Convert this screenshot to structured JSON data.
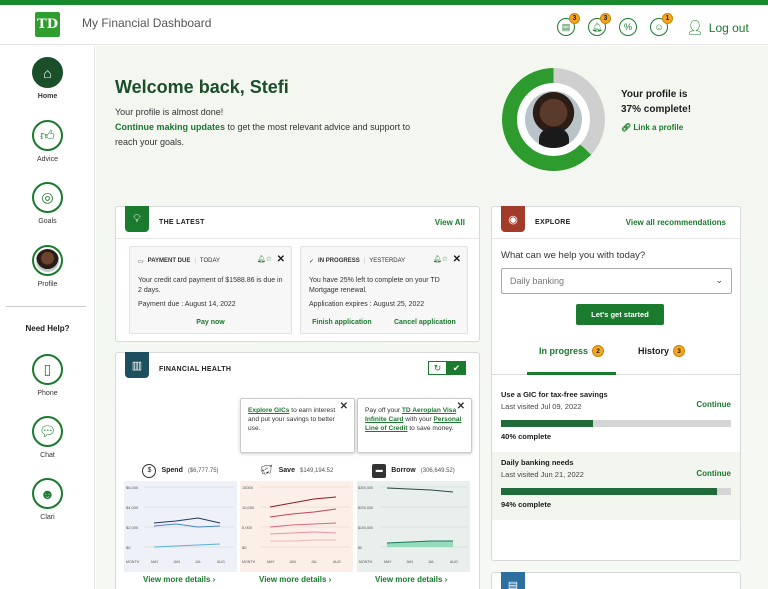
{
  "header": {
    "logo": "TD",
    "app_title": "My Financial Dashboard",
    "icons": [
      {
        "name": "statement-icon",
        "badge": "3"
      },
      {
        "name": "bell-icon",
        "badge": "3"
      },
      {
        "name": "offers-icon",
        "badge": ""
      },
      {
        "name": "goals-icon",
        "badge": "1"
      }
    ],
    "logout": "Log out"
  },
  "sidebar": {
    "items": [
      {
        "label": "Home",
        "icon": "home-icon"
      },
      {
        "label": "Advice",
        "icon": "thumbs-up-icon"
      },
      {
        "label": "Goals",
        "icon": "target-icon"
      },
      {
        "label": "Profile",
        "icon": "profile-avatar"
      }
    ],
    "need_help": "Need Help?",
    "help_items": [
      {
        "label": "Phone",
        "icon": "phone-icon"
      },
      {
        "label": "Chat",
        "icon": "chat-icon"
      },
      {
        "label": "Clari",
        "icon": "bot-icon"
      }
    ]
  },
  "welcome": {
    "title": "Welcome back, Stefi",
    "line1": "Your profile is almost done!",
    "link": "Continue making updates",
    "line2": " to get the most relevant advice and support to reach your goals."
  },
  "profile": {
    "complete_line1": "Your profile is",
    "complete_line2": "37% complete!",
    "percent": 37,
    "link": "Link a profile"
  },
  "latest": {
    "title": "THE LATEST",
    "view_all": "View All",
    "items": [
      {
        "status": "PAYMENT DUE",
        "when": "TODAY",
        "text": "Your credit card payment of $1588.86 is due in 2 days.",
        "detail": "Payment due : August 14, 2022",
        "actions": [
          "Pay now"
        ]
      },
      {
        "status": "IN PROGRESS",
        "when": "YESTERDAY",
        "text": "You have 25% left to complete on your TD Mortgage renewal.",
        "detail": "Application expires : August 25, 2022",
        "actions": [
          "Finish application",
          "Cancel application"
        ]
      }
    ]
  },
  "health": {
    "title": "FINANCIAL HEALTH",
    "tips": [
      {
        "link": "Explore GICs",
        "text": " to earn interest and put your savings to better use."
      },
      {
        "pre": "Pay off your ",
        "link1": "TD Aeroplan Visa Infinite Card",
        "mid": " with your ",
        "link2": "Personal Line of Credit",
        "post": " to save money."
      }
    ],
    "columns": [
      {
        "label": "Spend",
        "amount": "($6,777.75)",
        "icon": "dollar-icon",
        "y_ticks": [
          "$6,000",
          "$4,000",
          "$2,000",
          "$0"
        ]
      },
      {
        "label": "Save",
        "amount": "$149,194.52",
        "icon": "piggy-bank-icon",
        "y_ticks": [
          "15000",
          "10,000",
          "5,000",
          "$0"
        ]
      },
      {
        "label": "Borrow",
        "amount": "(306,649.52)",
        "icon": "credit-card-icon",
        "y_ticks": [
          "$300,000",
          "$200,000",
          "$100,000",
          "$0"
        ]
      }
    ],
    "months": [
      "MONTH",
      "MAY",
      "JUN",
      "JUL",
      "AUG"
    ],
    "view_more": "View more details ›"
  },
  "explore": {
    "title": "EXPLORE",
    "view_all": "View all recommendations",
    "question": "What can we help you with today?",
    "select_value": "Daily banking",
    "button": "Let's get started",
    "tabs": [
      {
        "label": "In progress",
        "badge": "2"
      },
      {
        "label": "History",
        "badge": "3"
      }
    ],
    "progress": [
      {
        "title": "Use a GIC for tax-free savings",
        "sub": "Last visited Jul 09, 2022",
        "action": "Continue",
        "percent": 40,
        "percent_text": "40% complete"
      },
      {
        "title": "Daily banking needs",
        "sub": "Last visited Jun 21, 2022",
        "action": "Continue",
        "percent": 94,
        "percent_text": "94% complete"
      }
    ]
  },
  "colors": {
    "brand_green": "#1a7a2e",
    "dark_green": "#1a4f2a",
    "badge_orange": "#f5a623"
  }
}
